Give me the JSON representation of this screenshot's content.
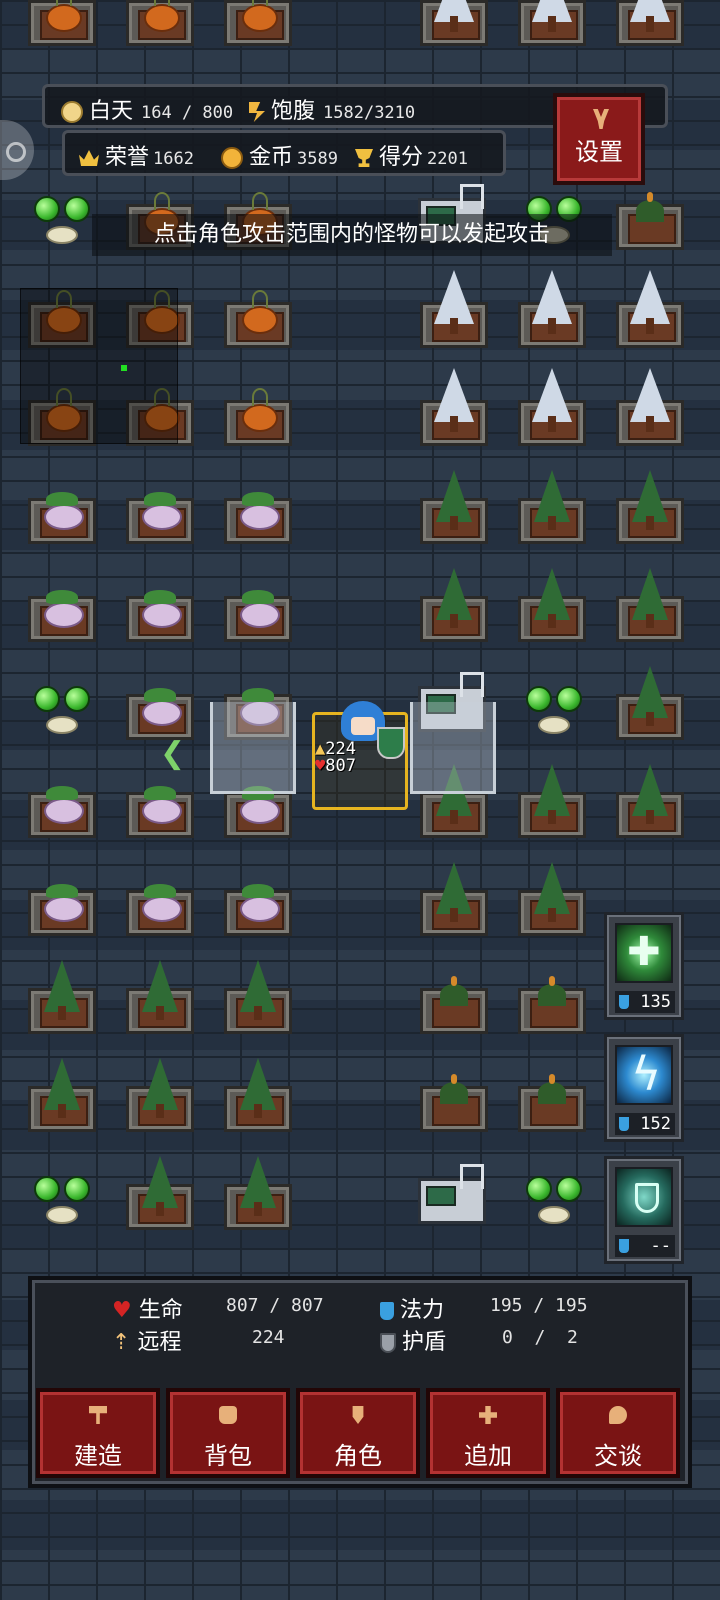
{
  "hud": {
    "day_label": "白天",
    "day_value": "164 / 800",
    "satiety_label": "饱腹",
    "satiety_value": "1582/3210",
    "honor_label": "荣誉",
    "honor_value": "1662",
    "gold_label": "金币",
    "gold_value": "3589",
    "score_label": "得分",
    "score_value": "2201",
    "settings_label": "设置"
  },
  "hint": "点击角色攻击范围内的怪物可以发起攻击",
  "player": {
    "attack": "224",
    "hp": "807"
  },
  "skills": [
    {
      "name": "heal-cross",
      "cost": "135"
    },
    {
      "name": "lightning",
      "cost": "152"
    },
    {
      "name": "shield",
      "cost": "--"
    }
  ],
  "status": {
    "hp_label": "生命",
    "hp_value": "807 / 807",
    "mana_label": "法力",
    "mana_value": "195 / 195",
    "ranged_label": "远程",
    "ranged_value": "224",
    "shield_label": "护盾",
    "shield_value": "0  /  2"
  },
  "buttons": {
    "build": "建造",
    "bag": "背包",
    "character": "角色",
    "add": "追加",
    "talk": "交谈"
  },
  "colors": {
    "accent_red": "#7a1414",
    "player_frame": "#e6b420",
    "minimap_marker": "#22e022"
  }
}
